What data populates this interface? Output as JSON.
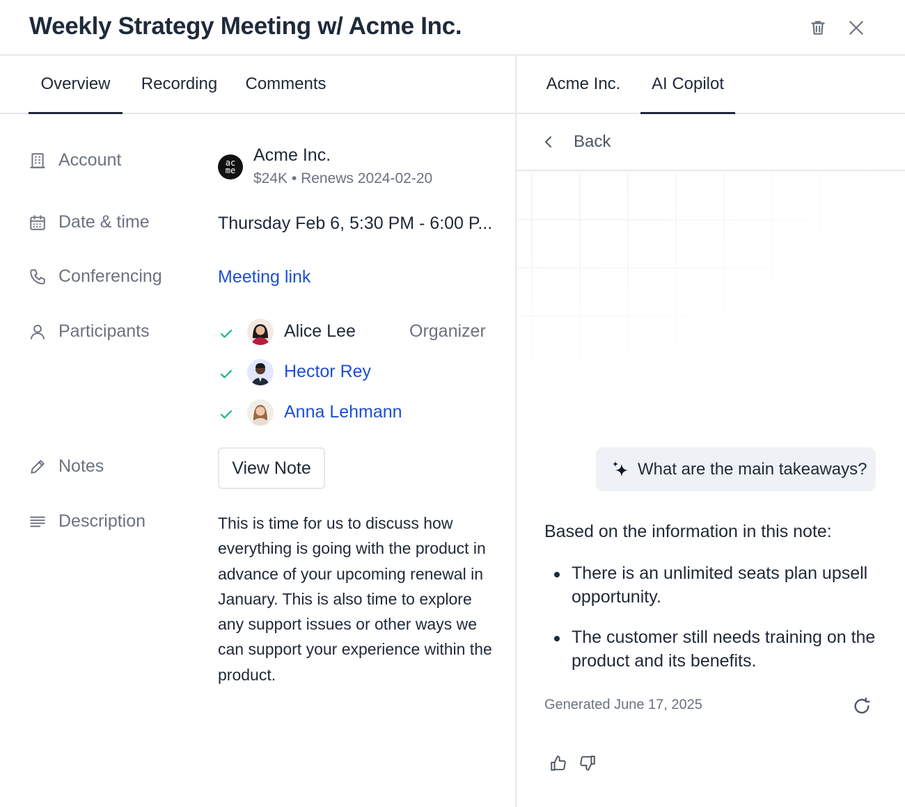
{
  "header": {
    "title": "Weekly Strategy Meeting w/ Acme Inc.",
    "delete_icon": "trash-icon",
    "close_icon": "close-icon"
  },
  "left_tabs": [
    {
      "label": "Overview",
      "active": true
    },
    {
      "label": "Recording",
      "active": false
    },
    {
      "label": "Comments",
      "active": false
    }
  ],
  "right_tabs": [
    {
      "label": "Acme Inc.",
      "active": false
    },
    {
      "label": "AI Copilot",
      "active": true
    }
  ],
  "details": {
    "account": {
      "label": "Account",
      "icon": "building-icon",
      "logo_text": "ac me",
      "name": "Acme Inc.",
      "sub": "$24K • Renews 2024-02-20"
    },
    "datetime": {
      "label": "Date & time",
      "icon": "calendar-icon",
      "value": "Thursday Feb 6, 5:30 PM - 6:00 P..."
    },
    "conferencing": {
      "label": "Conferencing",
      "icon": "phone-icon",
      "value": "Meeting link"
    },
    "participants": {
      "label": "Participants",
      "icon": "user-icon",
      "list": [
        {
          "name": "Alice Lee",
          "role": "Organizer",
          "accepted": true
        },
        {
          "name": "Hector Rey",
          "role": "",
          "accepted": true
        },
        {
          "name": "Anna Lehmann",
          "role": "",
          "accepted": true
        }
      ]
    },
    "notes": {
      "label": "Notes",
      "icon": "pencil-icon",
      "button": "View Note"
    },
    "description": {
      "label": "Description",
      "icon": "text-lines-icon",
      "text": "This is time for us to discuss how everything is going with the product in advance of your upcoming renewal in January. This is also time to explore any support issues or other ways we can support your experience within the product."
    }
  },
  "copilot": {
    "back_label": "Back",
    "prompt": "What are the main takeaways?",
    "answer_intro": "Based on the information in this note:",
    "bullets": [
      "There is an unlimited seats plan upsell opportunity.",
      "The customer still needs training on the product and its benefits."
    ],
    "generated": "Generated June 17, 2025"
  },
  "colors": {
    "link": "#1d4ed8",
    "check": "#10b981",
    "muted": "#6b7280",
    "prompt_bg": "#eef1f5"
  }
}
